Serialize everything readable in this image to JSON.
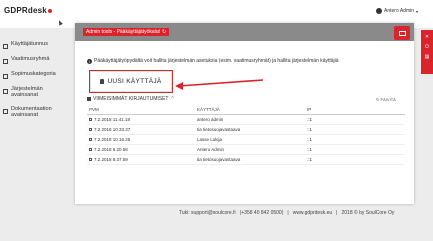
{
  "app": {
    "logo_text": "GDPRdesk"
  },
  "user": {
    "name": "Antero Admin"
  },
  "sidebar": {
    "items": [
      {
        "label": "Käyttäjätunnus"
      },
      {
        "label": "Vaatimusryhmä"
      },
      {
        "label": "Sopimuskategoria"
      },
      {
        "label": "Järjestelmän avainsanat"
      },
      {
        "label": "Dokumentaation avainsanat"
      }
    ]
  },
  "card": {
    "tag": "Admin tools - Pääkäyttäjätyökalut",
    "info": "Pääkäyttäjätyöpydältä voit hallita järjestelmän asetuksia (esim. vaatimusryhmät) ja hallita järjestelmän käyttäjiä",
    "new_user_button": "UUSI KÄYTTÄJÄ",
    "recent_logins_title": "VIIMEISIMMÄT KIRJAUTUMISET",
    "refresh_label": "PÄIVITÄ"
  },
  "logins": {
    "headers": [
      "PVM",
      "KÄYTTÄJÄ",
      "IP"
    ],
    "rows": [
      {
        "date": "7.2.2018 11.41.18",
        "user": "antero admin",
        "ip": "::1"
      },
      {
        "date": "7.2.2018 10.33.37",
        "user": "tia tietosuojavastaava",
        "ip": "::1"
      },
      {
        "date": "7.2.2018 10.16.25",
        "user": "Lasse Lukija",
        "ip": "::1"
      },
      {
        "date": "7.2.2018 9.20.58",
        "user": "Antero Admin",
        "ip": "::1"
      },
      {
        "date": "7.2.2018 8.37.59",
        "user": "tia tietosuojavastaava",
        "ip": "::1"
      }
    ]
  },
  "footer": {
    "support": "Tuki: support@soulcore.fi",
    "phone": "(+358 40 842 0500)",
    "site": "www.gdprdesk.eu",
    "copyright": "2018 © by SoulCore Oy",
    "sep": "|"
  },
  "colors": {
    "accent": "#d9242c",
    "header": "#8a8a8a",
    "background": "#ececec"
  }
}
